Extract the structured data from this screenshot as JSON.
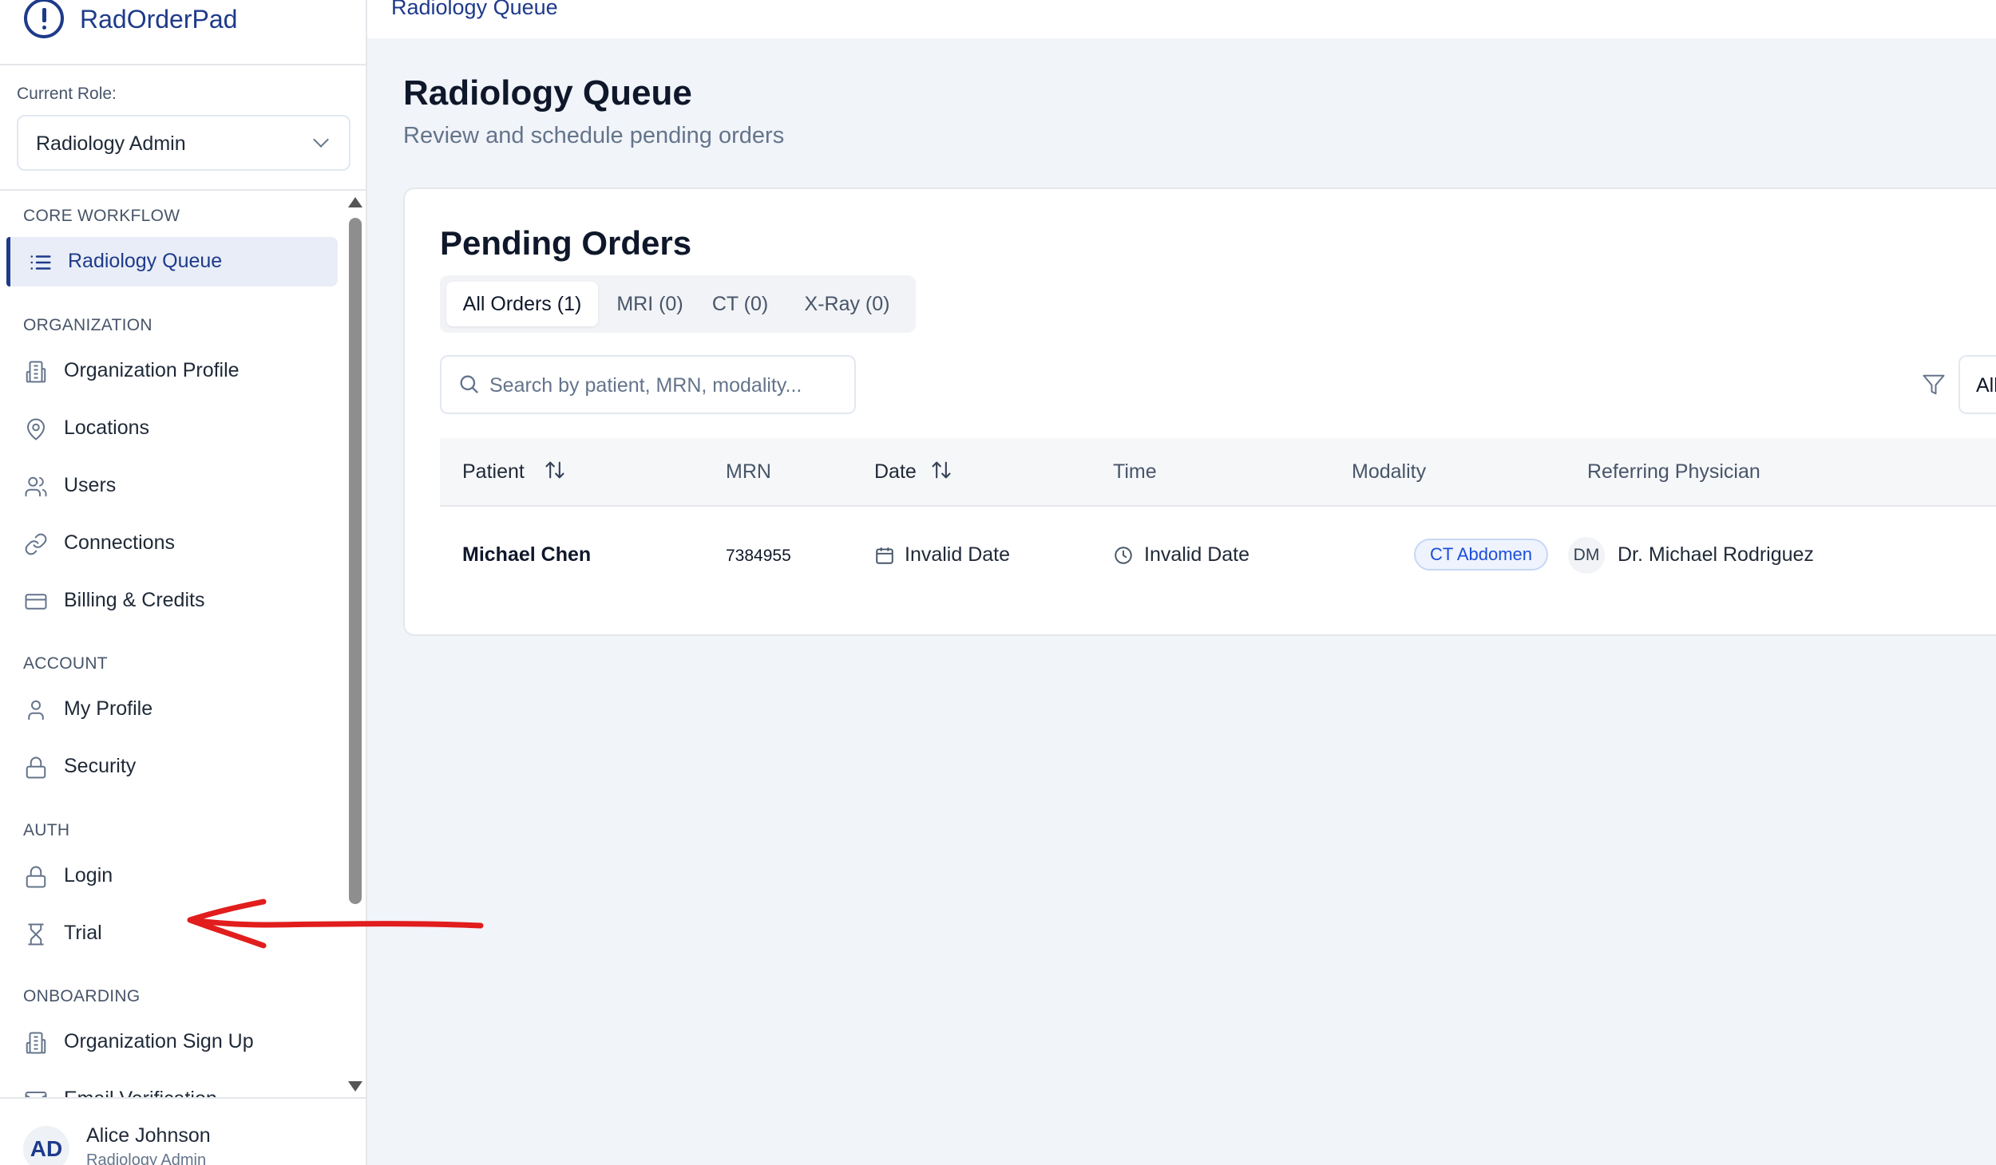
{
  "app": {
    "name": "RadOrderPad"
  },
  "role": {
    "label": "Current Role:",
    "value": "Radiology Admin"
  },
  "sidebar": {
    "sections": [
      {
        "title": "CORE WORKFLOW",
        "items": [
          {
            "label": "Radiology Queue",
            "icon": "list-icon",
            "active": true
          }
        ]
      },
      {
        "title": "ORGANIZATION",
        "items": [
          {
            "label": "Organization Profile",
            "icon": "building-icon"
          },
          {
            "label": "Locations",
            "icon": "map-pin-icon"
          },
          {
            "label": "Users",
            "icon": "users-icon"
          },
          {
            "label": "Connections",
            "icon": "link-icon"
          },
          {
            "label": "Billing & Credits",
            "icon": "credit-card-icon"
          }
        ]
      },
      {
        "title": "ACCOUNT",
        "items": [
          {
            "label": "My Profile",
            "icon": "user-icon"
          },
          {
            "label": "Security",
            "icon": "lock-icon"
          }
        ]
      },
      {
        "title": "AUTH",
        "items": [
          {
            "label": "Login",
            "icon": "lock-icon"
          },
          {
            "label": "Trial",
            "icon": "hourglass-icon"
          }
        ]
      },
      {
        "title": "ONBOARDING",
        "items": [
          {
            "label": "Organization Sign Up",
            "icon": "building-icon"
          },
          {
            "label": "Email Verification",
            "icon": "mail-icon"
          }
        ]
      }
    ]
  },
  "user": {
    "initials": "AD",
    "name": "Alice Johnson",
    "role": "Radiology Admin"
  },
  "header": {
    "breadcrumb": "Radiology Queue"
  },
  "page": {
    "title": "Radiology Queue",
    "subtitle": "Review and schedule pending orders"
  },
  "orders": {
    "title": "Pending Orders",
    "tabs": [
      "All Orders (1)",
      "MRI (0)",
      "CT (0)",
      "X-Ray (0)"
    ],
    "search_placeholder": "Search by patient, MRN, modality...",
    "filter_value": "All",
    "columns": [
      "Patient",
      "MRN",
      "Date",
      "Time",
      "Modality",
      "Referring Physician"
    ],
    "rows": [
      {
        "patient": "Michael Chen",
        "mrn": "7384955",
        "date": "Invalid Date",
        "time": "Invalid Date",
        "modality": "CT Abdomen",
        "physician_initials": "DM",
        "physician": "Dr. Michael Rodriguez"
      }
    ]
  },
  "colors": {
    "brand": "#1e3a8a",
    "badge": "#1d4ed8",
    "annotation": "#e11d1d"
  }
}
